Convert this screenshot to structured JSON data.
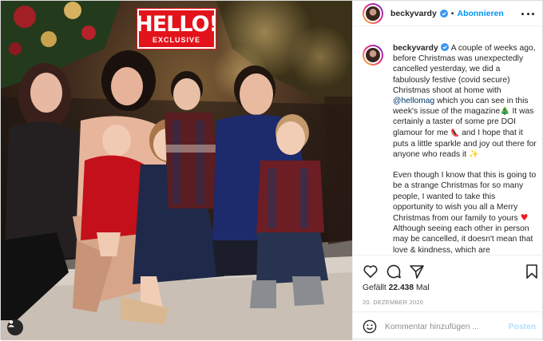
{
  "post": {
    "image": {
      "alt_description": "",
      "logo": {
        "word": "HELLO!",
        "subtitle": "EXCLUSIVE"
      }
    },
    "header": {
      "username": "beckyvardy",
      "verified": true,
      "separator": "•",
      "follow_label": "Abonnieren"
    },
    "caption": {
      "username": "beckyvardy",
      "paragraph1_before_mention": "A couple of weeks ago, before Christmas was unexpectedly cancelled yesterday, we did a fabulously festive (covid secure) Christmas shoot at home with ",
      "mention": "@hellomag",
      "paragraph1_after_mention": " which you can see in this week's issue of the magazine",
      "paragraph1_part3": " It was certainly a taster of some pre DOI glamour for me ",
      "paragraph1_part4": " and I hope that it puts a little sparkle and joy out there for anyone who reads it ",
      "paragraph2_part1": "Even though I know that this is going to be a strange Christmas for so many people, I wanted to take this opportunity to wish you all a Merry Christmas from our family to yours ",
      "paragraph2_part2": " Although seeing each other in person may be cancelled, it doesn't mean that love & kindness, which are",
      "emoji_tree": "🎄",
      "emoji_boot": "👠",
      "emoji_sparkle": "✨",
      "emoji_heart": "♥"
    },
    "likes": {
      "prefix": "Gefällt",
      "count": "22.438",
      "suffix": "Mal"
    },
    "date": "20. DEZEMBER 2020",
    "comment": {
      "placeholder": "Kommentar hinzufügen ...",
      "post_label": "Posten"
    },
    "icons": {
      "like": "heart-icon",
      "comment": "comment-bubble-icon",
      "share": "paper-plane-icon",
      "save": "bookmark-icon",
      "more": "more-options-icon",
      "emoji": "smiley-icon",
      "user_tag": "user-tag-icon"
    },
    "colors": {
      "follow_blue": "#0095f6",
      "post_button_disabled": "#b2dffc",
      "mention": "#00376b",
      "logo_red": "#e3131b",
      "muted_text": "#8e8e8e"
    }
  }
}
